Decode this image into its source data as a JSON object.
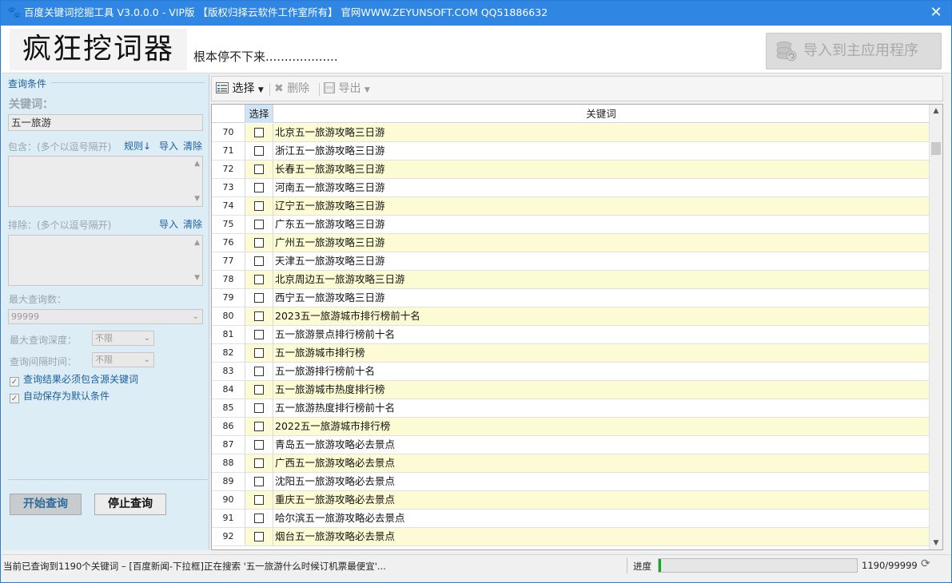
{
  "window": {
    "title": "百度关键词挖掘工具 V3.0.0.0 - VIP版 【版权归择云软件工作室所有】 官网WWW.ZEYUNSOFT.COM QQ51886632",
    "close_glyph": "✕"
  },
  "header": {
    "logo_text": "疯狂挖词器",
    "slogan": "根本停不下来...................",
    "import_button": "导入到主应用程序"
  },
  "query_panel": {
    "group_title": "查询条件",
    "keyword_label": "关键词：",
    "keyword_value": "五一旅游",
    "include_label": "包含：(多个以逗号隔开)",
    "include_rule_link": "规则↓",
    "include_import_link": "导入",
    "include_clear_link": "清除",
    "exclude_label": "排除：(多个以逗号隔开)",
    "exclude_import_link": "导入",
    "exclude_clear_link": "清除",
    "max_query_label": "最大查询数：",
    "max_query_value": "99999",
    "max_depth_label": "最大查询深度：",
    "max_depth_value": "不限",
    "interval_label": "查询间隔时间：",
    "interval_value": "不限",
    "check_must_contain": "查询结果必须包含源关键词",
    "check_must_contain_checked": true,
    "check_autosave": "自动保存为默认条件",
    "check_autosave_checked": true,
    "start_button": "开始查询",
    "stop_button": "停止查询"
  },
  "toolbar": {
    "select_label": "选择",
    "delete_label": "删除",
    "export_label": "导出"
  },
  "grid": {
    "col_select": "选择",
    "col_keyword": "关键词",
    "rows": [
      {
        "num": "70",
        "keyword": "北京五一旅游攻略三日游"
      },
      {
        "num": "71",
        "keyword": "浙江五一旅游攻略三日游"
      },
      {
        "num": "72",
        "keyword": "长春五一旅游攻略三日游"
      },
      {
        "num": "73",
        "keyword": "河南五一旅游攻略三日游"
      },
      {
        "num": "74",
        "keyword": "辽宁五一旅游攻略三日游"
      },
      {
        "num": "75",
        "keyword": "广东五一旅游攻略三日游"
      },
      {
        "num": "76",
        "keyword": "广州五一旅游攻略三日游"
      },
      {
        "num": "77",
        "keyword": "天津五一旅游攻略三日游"
      },
      {
        "num": "78",
        "keyword": "北京周边五一旅游攻略三日游"
      },
      {
        "num": "79",
        "keyword": "西宁五一旅游攻略三日游"
      },
      {
        "num": "80",
        "keyword": "2023五一旅游城市排行榜前十名"
      },
      {
        "num": "81",
        "keyword": "五一旅游景点排行榜前十名"
      },
      {
        "num": "82",
        "keyword": "五一旅游城市排行榜"
      },
      {
        "num": "83",
        "keyword": "五一旅游排行榜前十名"
      },
      {
        "num": "84",
        "keyword": "五一旅游城市热度排行榜"
      },
      {
        "num": "85",
        "keyword": "五一旅游热度排行榜前十名"
      },
      {
        "num": "86",
        "keyword": "2022五一旅游城市排行榜"
      },
      {
        "num": "87",
        "keyword": "青岛五一旅游攻略必去景点"
      },
      {
        "num": "88",
        "keyword": "广西五一旅游攻略必去景点"
      },
      {
        "num": "89",
        "keyword": "沈阳五一旅游攻略必去景点"
      },
      {
        "num": "90",
        "keyword": "重庆五一旅游攻略必去景点"
      },
      {
        "num": "91",
        "keyword": "哈尔滨五一旅游攻略必去景点"
      },
      {
        "num": "92",
        "keyword": "烟台五一旅游攻略必去景点"
      }
    ]
  },
  "status_bar": {
    "message": "当前已查询到1190个关键词  –  [百度新闻-下拉框]正在搜索 '五一旅游什么时候订机票最便宜'...",
    "progress_label": "进度",
    "progress_fraction": 0.0119,
    "count_text": "1190/99999"
  },
  "colors": {
    "titlebar": "#2f86e3",
    "panel_bg": "#ddedf6",
    "alt_row": "#fdfbd4",
    "progress_fill": "#06b025",
    "link": "#1b5f9c"
  }
}
